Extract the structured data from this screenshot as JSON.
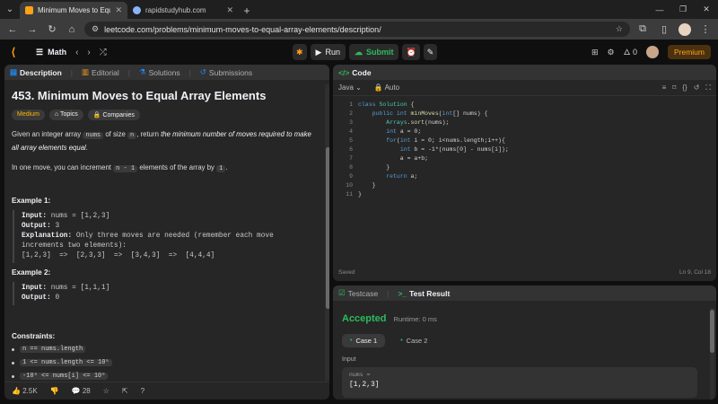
{
  "browser": {
    "tabs": [
      {
        "title": "Minimum Moves to Equal Arra",
        "active": true,
        "favicon_color": "#ffa116"
      },
      {
        "title": "rapidstudyhub.com",
        "active": false,
        "favicon_color": "#8ab4f8"
      }
    ],
    "url": "leetcode.com/problems/minimum-moves-to-equal-array-elements/description/"
  },
  "nav": {
    "section": "Math",
    "run_label": "Run",
    "submit_label": "Submit",
    "fire_count": "0",
    "premium_label": "Premium"
  },
  "description": {
    "tabs": [
      "Description",
      "Editorial",
      "Solutions",
      "Submissions"
    ],
    "title": "453. Minimum Moves to Equal Array Elements",
    "badges": [
      "Medium",
      "Topics",
      "Companies"
    ],
    "para1": {
      "a": "Given an integer array",
      "code1": "nums",
      "b": "of size",
      "code2": "n",
      "c": ", return",
      "italic": "the minimum number of moves required to make all array elements equal",
      "d": "."
    },
    "para2": {
      "a": "In one move, you can increment",
      "code": "n - 1",
      "b": "elements of the array by",
      "code2": "1",
      "c": "."
    },
    "example1": {
      "title": "Example 1:",
      "input_label": "Input:",
      "input": "nums = [1,2,3]",
      "output_label": "Output:",
      "output": "3",
      "explanation_label": "Explanation:",
      "explanation": "Only three moves are needed (remember each move increments two elements):",
      "steps": "[1,2,3]  =>  [2,3,3]  =>  [3,4,3]  =>  [4,4,4]"
    },
    "example2": {
      "title": "Example 2:",
      "input_label": "Input:",
      "input": "nums = [1,1,1]",
      "output_label": "Output:",
      "output": "0"
    },
    "constraints_title": "Constraints:",
    "constraints": [
      "n == nums.length",
      "1 <= nums.length <= 10⁵",
      "-10⁹ <= nums[i] <= 10⁹"
    ],
    "footer": {
      "likes": "2.5K",
      "comments": "28"
    }
  },
  "code": {
    "panel_title": "Code",
    "language": "Java",
    "mode": "Auto",
    "lines": [
      {
        "n": "1",
        "t": "class Solution {"
      },
      {
        "n": "2",
        "t": "    public int minMoves(int[] nums) {"
      },
      {
        "n": "3",
        "t": "        Arrays.sort(nums);"
      },
      {
        "n": "4",
        "t": "        int a = 0;"
      },
      {
        "n": "5",
        "t": "        for(int i = 0; i<nums.length;i++){"
      },
      {
        "n": "6",
        "t": "            int b = -1*(nums[0] - nums[i]);"
      },
      {
        "n": "7",
        "t": "            a = a+b;"
      },
      {
        "n": "8",
        "t": "        }"
      },
      {
        "n": "9",
        "t": "        return a;"
      },
      {
        "n": "10",
        "t": "    }"
      },
      {
        "n": "11",
        "t": "}"
      }
    ],
    "status": "Saved",
    "cursor": "Ln 9, Col 18"
  },
  "test": {
    "tabs": [
      "Testcase",
      "Test Result"
    ],
    "result": "Accepted",
    "runtime": "Runtime: 0 ms",
    "cases": [
      "Case 1",
      "Case 2"
    ],
    "input_label": "Input",
    "input_key": "nums =",
    "input_value": "[1,2,3]"
  }
}
